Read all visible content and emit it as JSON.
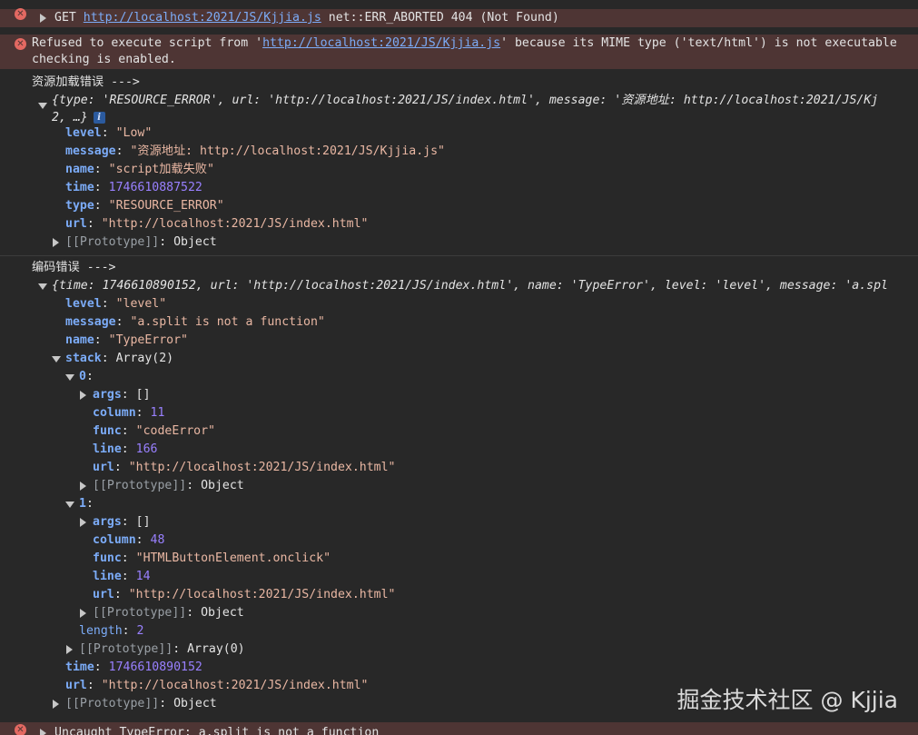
{
  "console": {
    "entry1": {
      "method": "GET",
      "url": "http://localhost:2021/JS/Kjjia.js",
      "status": "net::ERR_ABORTED 404 (Not Found)"
    },
    "entry2": {
      "prefix": "Refused to execute script from '",
      "url": "http://localhost:2021/JS/Kjjia.js",
      "suffix": "' because its MIME type ('text/html') is not executable",
      "line2": "checking is enabled."
    },
    "resource_log": {
      "label": "资源加载错误 --->",
      "preview_line1": "{type: 'RESOURCE_ERROR', url: 'http://localhost:2021/JS/index.html', message: '资源地址: http://localhost:2021/JS/Kj",
      "preview_line2": "2, …}",
      "info": "i",
      "props": [
        {
          "key": "level",
          "value": "\"Low\""
        },
        {
          "key": "message",
          "value": "\"资源地址: http://localhost:2021/JS/Kjjia.js\""
        },
        {
          "key": "name",
          "value": "\"script加载失败\""
        },
        {
          "key": "time",
          "value": "1746610887522"
        },
        {
          "key": "type",
          "value": "\"RESOURCE_ERROR\""
        },
        {
          "key": "url",
          "value": "\"http://localhost:2021/JS/index.html\""
        }
      ],
      "prototype_key": "[[Prototype]]",
      "prototype_value": "Object"
    },
    "code_log": {
      "label": "编码错误 --->",
      "preview": "{time: 1746610890152, url: 'http://localhost:2021/JS/index.html', name: 'TypeError', level: 'level', message: 'a.spl",
      "level_key": "level",
      "level_value": "\"level\"",
      "message_key": "message",
      "message_value": "\"a.split is not a function\"",
      "name_key": "name",
      "name_value": "\"TypeError\"",
      "stack_key": "stack",
      "stack_value": "Array(2)",
      "frames": [
        {
          "index": "0",
          "args_key": "args",
          "args_value": "[]",
          "column_key": "column",
          "column_value": "11",
          "func_key": "func",
          "func_value": "\"codeError\"",
          "line_key": "line",
          "line_value": "166",
          "url_key": "url",
          "url_value": "\"http://localhost:2021/JS/index.html\""
        },
        {
          "index": "1",
          "args_key": "args",
          "args_value": "[]",
          "column_key": "column",
          "column_value": "48",
          "func_key": "func",
          "func_value": "\"HTMLButtonElement.onclick\"",
          "line_key": "line",
          "line_value": "14",
          "url_key": "url",
          "url_value": "\"http://localhost:2021/JS/index.html\""
        }
      ],
      "length_key": "length",
      "length_value": "2",
      "array_proto_key": "[[Prototype]]",
      "array_proto_value": "Array(0)",
      "time_key": "time",
      "time_value": "1746610890152",
      "url_key": "url",
      "url_value": "\"http://localhost:2021/JS/index.html\"",
      "prototype_key": "[[Prototype]]",
      "prototype_value": "Object"
    },
    "entry_last": {
      "text": "Uncaught TypeError: a.split is not a function"
    },
    "error_icon": "x-circle-icon",
    "watermark": "掘金技术社区 @ Kjjia"
  }
}
